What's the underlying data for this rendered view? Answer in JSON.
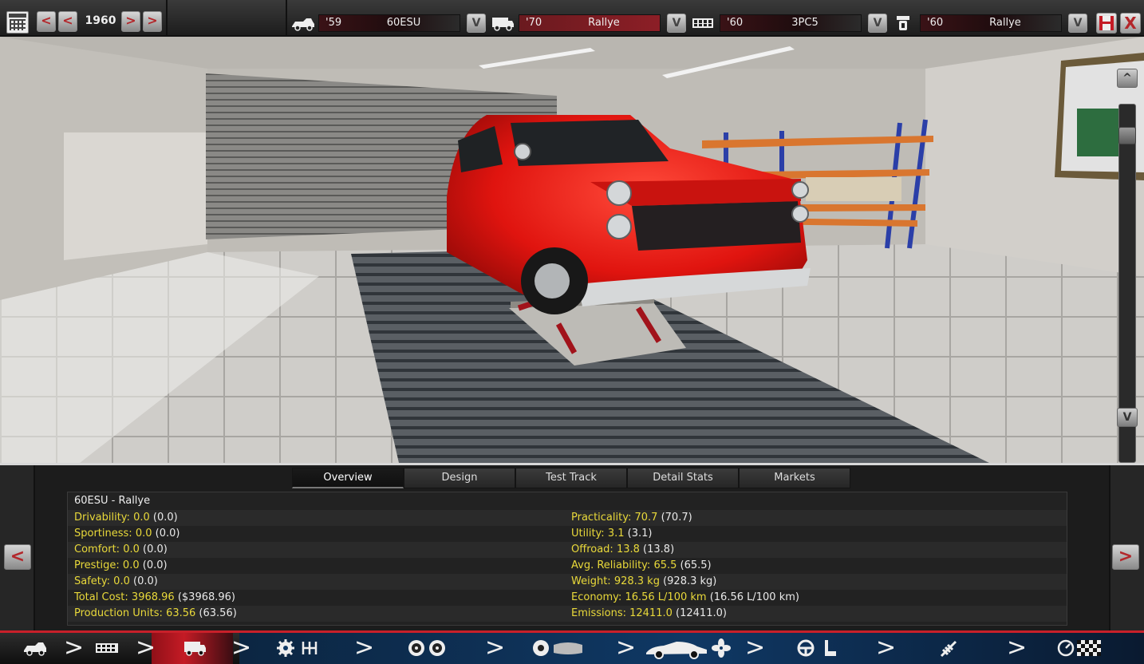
{
  "topbar": {
    "year": "1960",
    "prev_label": "<",
    "next_label": ">",
    "selectors": [
      {
        "icon": "body-chassis-icon",
        "year": "'59",
        "name": "60ESU",
        "active": false
      },
      {
        "icon": "car-model-icon",
        "year": "'70",
        "name": "Rallye",
        "active": true
      },
      {
        "icon": "engine-block-icon",
        "year": "'60",
        "name": "3PC5",
        "active": false
      },
      {
        "icon": "engine-variant-icon",
        "year": "'60",
        "name": "Rallye",
        "active": false
      }
    ],
    "dropdown_label": "V",
    "close_label": "X"
  },
  "scene": {
    "scroll_up": "^",
    "scroll_down": "V"
  },
  "tabs": [
    {
      "label": "Overview",
      "active": true
    },
    {
      "label": "Design",
      "active": false
    },
    {
      "label": "Test Track",
      "active": false
    },
    {
      "label": "Detail Stats",
      "active": false
    },
    {
      "label": "Markets",
      "active": false
    }
  ],
  "panel": {
    "prev_label": "<",
    "next_label": ">",
    "car_title": "60ESU - Rallye",
    "left_stats": [
      {
        "label": "Drivability:",
        "value": "0.0",
        "extra": "(0.0)"
      },
      {
        "label": "Sportiness:",
        "value": "0.0",
        "extra": "(0.0)"
      },
      {
        "label": "Comfort:",
        "value": "0.0",
        "extra": "(0.0)"
      },
      {
        "label": "Prestige:",
        "value": "0.0",
        "extra": "(0.0)"
      },
      {
        "label": "Safety:",
        "value": "0.0",
        "extra": "(0.0)"
      },
      {
        "label": "Total Cost:",
        "value": "3968.96",
        "extra": "($3968.96)"
      },
      {
        "label": "Production Units:",
        "value": "63.56",
        "extra": "(63.56)"
      }
    ],
    "right_stats": [
      {
        "label": "Practicality:",
        "value": "70.7",
        "extra": "(70.7)"
      },
      {
        "label": "Utility:",
        "value": "3.1",
        "extra": "(3.1)"
      },
      {
        "label": "Offroad:",
        "value": "13.8",
        "extra": "(13.8)"
      },
      {
        "label": "Avg. Reliability:",
        "value": "65.5",
        "extra": "(65.5)"
      },
      {
        "label": "Weight:",
        "value": "928.3 kg",
        "extra": "(928.3 kg)"
      },
      {
        "label": "Economy:",
        "value": "16.56 L/100 km",
        "extra": "(16.56 L/100 km)"
      },
      {
        "label": "Emissions:",
        "value": "12411.0",
        "extra": "(12411.0)"
      }
    ]
  },
  "navbar": {
    "items": [
      {
        "name": "nav-body-chassis",
        "icons": [
          "chassis-icon"
        ]
      },
      {
        "name": "nav-engine",
        "icons": [
          "engine-icon"
        ]
      },
      {
        "name": "nav-model",
        "icons": [
          "car-model-icon"
        ],
        "active": true
      },
      {
        "name": "nav-drivetrain",
        "icons": [
          "gear-icon",
          "gearshift-icon"
        ]
      },
      {
        "name": "nav-wheels",
        "icons": [
          "wheel-icon",
          "wheel-icon"
        ]
      },
      {
        "name": "nav-brakes-interior",
        "icons": [
          "brake-disc-icon",
          "panel-icon"
        ]
      },
      {
        "name": "nav-aero-cooling",
        "icons": [
          "sports-car-icon",
          "fan-icon"
        ]
      },
      {
        "name": "nav-steering-seats",
        "icons": [
          "steering-wheel-icon",
          "seat-icon"
        ]
      },
      {
        "name": "nav-suspension",
        "icons": [
          "shock-absorber-icon"
        ]
      },
      {
        "name": "nav-testing",
        "icons": [
          "gauge-icon",
          "checkered-flag-icon"
        ]
      }
    ],
    "chevron": ">"
  },
  "colors": {
    "accent_red": "#c41b25",
    "stat_yellow": "#e9d93a",
    "nav_blue": "#0f3864"
  }
}
